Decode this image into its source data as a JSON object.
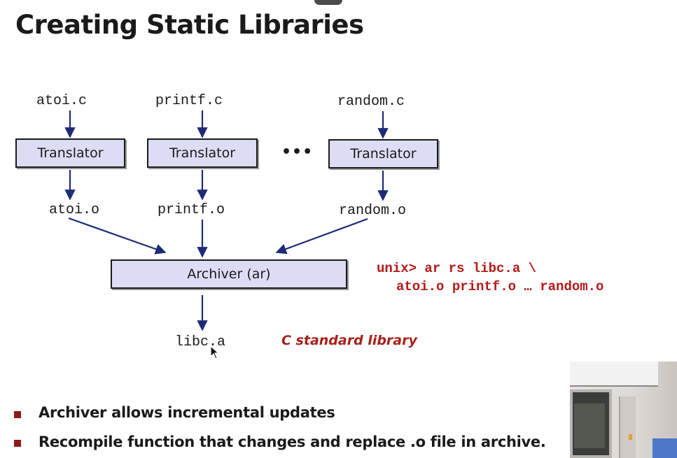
{
  "slide": {
    "title": "Creating Static Libraries"
  },
  "sources": [
    "atoi.c",
    "printf.c",
    "random.c"
  ],
  "translator_label": "Translator",
  "ellipsis": "•••",
  "objects": [
    "atoi.o",
    "printf.o",
    "random.o"
  ],
  "archiver_label": "Archiver (ar)",
  "output_file": "libc.a",
  "output_caption": "C standard library",
  "command": {
    "line1": "unix> ar rs libc.a \\",
    "line2": "atoi.o printf.o … random.o"
  },
  "bullets": [
    "Archiver allows incremental updates",
    "Recompile function that changes and replace .o file in archive."
  ],
  "colors": {
    "box_fill": "#dcdcf5",
    "arrow": "#1e2a78",
    "command_text": "#b51a1a",
    "bullet": "#8c1a1a"
  }
}
